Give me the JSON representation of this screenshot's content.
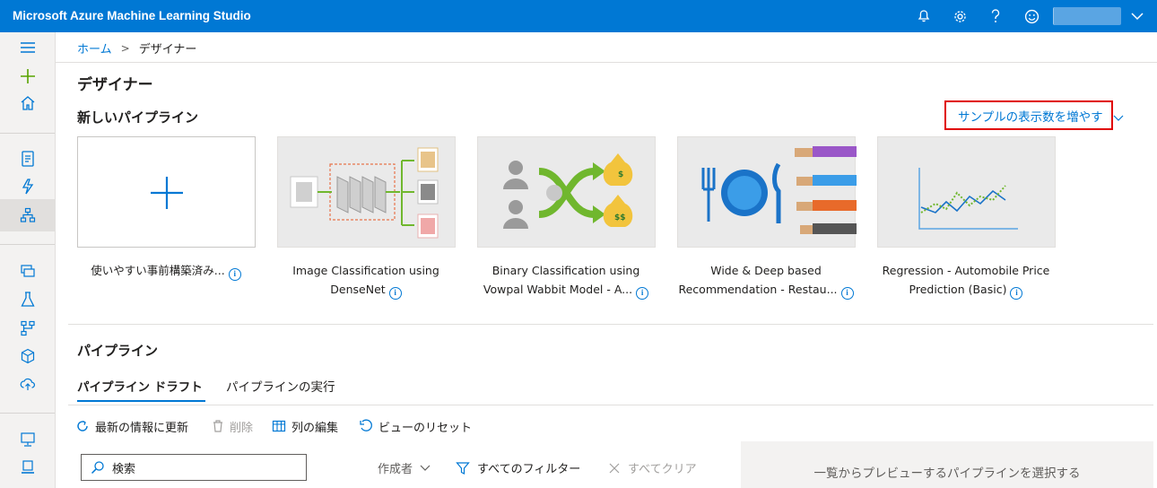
{
  "app": {
    "title": "Microsoft Azure Machine Learning Studio"
  },
  "topbar": {
    "icons": [
      "bell-icon",
      "gear-icon",
      "help-icon",
      "smiley-icon",
      "chevron-down-icon"
    ]
  },
  "nav": {
    "icons": [
      "hamburger-icon",
      "plus-icon",
      "home-icon",
      "notebook-icon",
      "automl-icon",
      "designer-icon",
      "datasets-icon",
      "experiments-icon",
      "pipelines-icon",
      "models-icon",
      "endpoints-icon",
      "compute-icon",
      "datastores-icon"
    ]
  },
  "breadcrumb": {
    "home": "ホーム",
    "separator": ">",
    "current": "デザイナー"
  },
  "page": {
    "title": "デザイナー"
  },
  "new_pipeline": {
    "title": "新しいパイプライン",
    "more_samples": "サンプルの表示数を増やす",
    "cards": [
      {
        "line1": "使いやすい事前構築済み...",
        "line2": ""
      },
      {
        "line1": "Image Classification using",
        "line2": "DenseNet"
      },
      {
        "line1": "Binary Classification using",
        "line2": "Vowpal Wabbit Model - A..."
      },
      {
        "line1": "Wide & Deep based",
        "line2": "Recommendation - Restau..."
      },
      {
        "line1": "Regression - Automobile Price",
        "line2": "Prediction (Basic)"
      }
    ]
  },
  "pipelines": {
    "title": "パイプライン",
    "tabs": [
      "パイプライン ドラフト",
      "パイプラインの実行"
    ],
    "toolbar": {
      "refresh": "最新の情報に更新",
      "delete": "削除",
      "edit_columns": "列の編集",
      "reset_view": "ビューのリセット"
    },
    "search_placeholder": "検索",
    "author_filter": "作成者",
    "all_filters": "すべてのフィルター",
    "clear_all": "すべてクリア",
    "preview_hint": "一覧からプレビューするパイプラインを選択する"
  },
  "colors": {
    "accent": "#0078d4",
    "highlight_box": "#e00000"
  }
}
